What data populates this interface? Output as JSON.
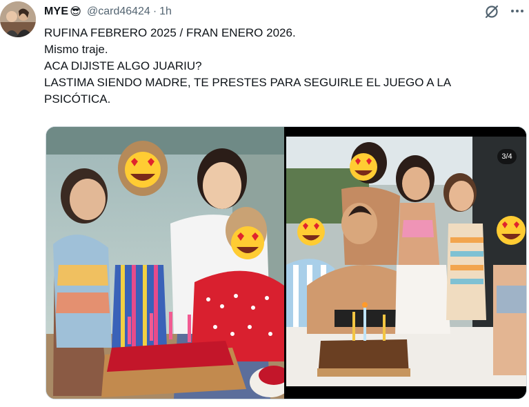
{
  "tweet": {
    "author_name": "MYE",
    "author_emoji": "😎",
    "handle": "@card46424",
    "separator": "·",
    "time": "1h",
    "lines": [
      "RUFINA FEBRERO 2025 / FRAN ENERO 2026.",
      "Mismo traje.",
      "ACA DIJISTE ALGO JUARIU?",
      "LASTIMA SIENDO MADRE, TE PRESTES PARA SEGUIRLE EL JUEGO A LA",
      "PSICÓTICA."
    ]
  },
  "media": {
    "counter": "3/4"
  },
  "icons": {
    "grok": "grok-icon",
    "more": "more-icon",
    "face": "heart-eyes-emoji"
  },
  "colors": {
    "secondary_text": "#536471",
    "border": "#cfd9de"
  }
}
